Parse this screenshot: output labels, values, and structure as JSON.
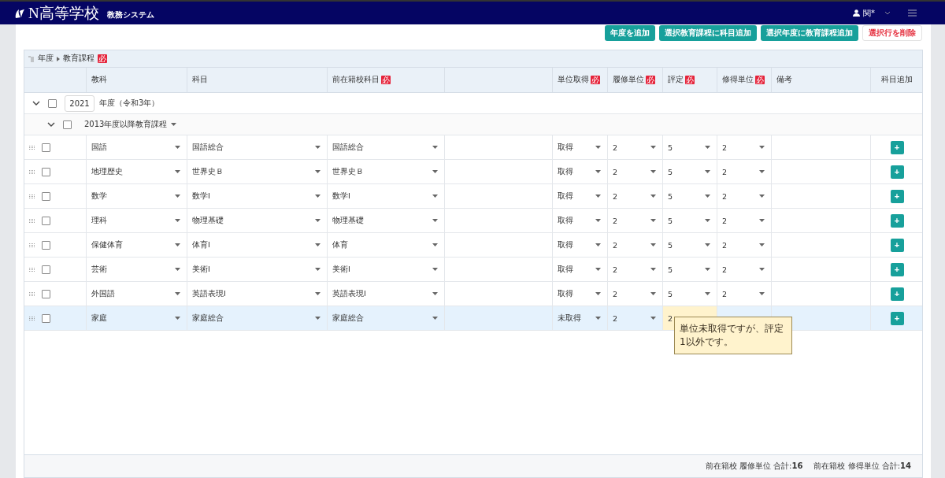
{
  "header": {
    "logo": "N高等学校",
    "subtitle": "教務システム",
    "user": "関*"
  },
  "actions": [
    {
      "label": "年度を追加",
      "kind": "primary"
    },
    {
      "label": "選択教育課程に科目追加",
      "kind": "primary"
    },
    {
      "label": "選択年度に教育課程追加",
      "kind": "primary"
    },
    {
      "label": "選択行を削除",
      "kind": "danger"
    }
  ],
  "breadcrumb": [
    {
      "label": "年度"
    },
    {
      "label": "教育課程",
      "badge": "必"
    }
  ],
  "columns": [
    {
      "label": "教科"
    },
    {
      "label": "科目"
    },
    {
      "label": "前在籍校科目",
      "badge": "必"
    },
    {
      "label": "単位取得",
      "badge": "必"
    },
    {
      "label": "履修単位",
      "badge": "必"
    },
    {
      "label": "評定",
      "badge": "必"
    },
    {
      "label": "修得単位",
      "badge": "必"
    },
    {
      "label": "備考"
    },
    {
      "label": "科目追加"
    }
  ],
  "year": {
    "value": "2021",
    "label": "年度（令和3年）",
    "expanded": true,
    "checked": false
  },
  "curriculum": {
    "label": "2013年度以降教育課程",
    "expanded": true,
    "checked": false
  },
  "rows": [
    {
      "subject_area": "国語",
      "subject": "国語総合",
      "prior_subject": "国語総合",
      "credit_status": "取得",
      "registered_units": "2",
      "grade": "5",
      "earned_units": "2",
      "checked": false,
      "selected": false,
      "grade_warning": false
    },
    {
      "subject_area": "地理歴史",
      "subject": "世界史Ｂ",
      "prior_subject": "世界史Ｂ",
      "credit_status": "取得",
      "registered_units": "2",
      "grade": "5",
      "earned_units": "2",
      "checked": false,
      "selected": false,
      "grade_warning": false
    },
    {
      "subject_area": "数学",
      "subject": "数学Ⅰ",
      "prior_subject": "数学Ⅰ",
      "credit_status": "取得",
      "registered_units": "2",
      "grade": "5",
      "earned_units": "2",
      "checked": false,
      "selected": false,
      "grade_warning": false
    },
    {
      "subject_area": "理科",
      "subject": "物理基礎",
      "prior_subject": "物理基礎",
      "credit_status": "取得",
      "registered_units": "2",
      "grade": "5",
      "earned_units": "2",
      "checked": false,
      "selected": false,
      "grade_warning": false
    },
    {
      "subject_area": "保健体育",
      "subject": "体育Ⅰ",
      "prior_subject": "体育",
      "credit_status": "取得",
      "registered_units": "2",
      "grade": "5",
      "earned_units": "2",
      "checked": false,
      "selected": false,
      "grade_warning": false
    },
    {
      "subject_area": "芸術",
      "subject": "美術Ⅰ",
      "prior_subject": "美術Ⅰ",
      "credit_status": "取得",
      "registered_units": "2",
      "grade": "5",
      "earned_units": "2",
      "checked": false,
      "selected": false,
      "grade_warning": false
    },
    {
      "subject_area": "外国語",
      "subject": "英語表現Ⅰ",
      "prior_subject": "英語表現Ⅰ",
      "credit_status": "取得",
      "registered_units": "2",
      "grade": "5",
      "earned_units": "2",
      "checked": false,
      "selected": false,
      "grade_warning": false
    },
    {
      "subject_area": "家庭",
      "subject": "家庭総合",
      "prior_subject": "家庭総合",
      "credit_status": "未取得",
      "registered_units": "2",
      "grade": "2",
      "checked": false,
      "selected": true,
      "grade_warning": true,
      "tooltip": "単位未取得ですが、評定1以外です。"
    }
  ],
  "add_button": "+",
  "footer": [
    "前在籍校 履修単位 合計:**16**",
    "前在籍校 修得単位 合計:**14**"
  ]
}
